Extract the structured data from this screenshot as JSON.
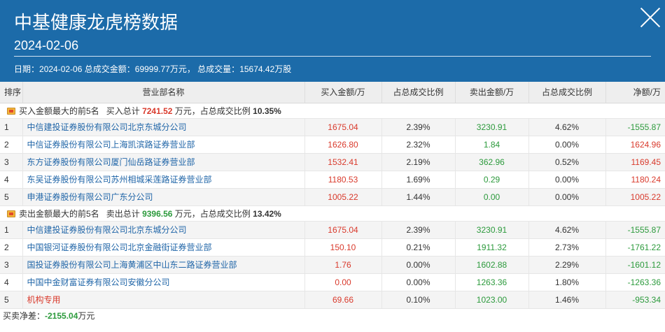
{
  "header": {
    "title": "中基健康龙虎榜数据",
    "date": "2024-02-06",
    "summary_date_label": "日期：",
    "summary_date": "2024-02-06",
    "summary_amount_label": "总成交金额：",
    "summary_amount": "69999.77万元，",
    "summary_volume_label": "总成交量：",
    "summary_volume": "15674.42万股"
  },
  "columns": [
    "排序",
    "营业部名称",
    "买入金额/万",
    "占总成交比例",
    "卖出金额/万",
    "占总成交比例",
    "净额/万"
  ],
  "buy_section": {
    "label": "买入金额最大的前5名",
    "total_label": "买入总计",
    "total": "7241.52",
    "total_unit": "万元，占总成交比例",
    "ratio": "10.35%"
  },
  "buy_rows": [
    {
      "rank": "1",
      "name": "中信建投证券股份有限公司北京东城分公司",
      "buy": "1675.04",
      "buy_pct": "2.39%",
      "sell": "3230.91",
      "sell_pct": "4.62%",
      "net": "-1555.87",
      "net_color": "green"
    },
    {
      "rank": "2",
      "name": "中信证券股份有限公司上海凯滨路证券营业部",
      "buy": "1626.80",
      "buy_pct": "2.32%",
      "sell": "1.84",
      "sell_pct": "0.00%",
      "net": "1624.96",
      "net_color": "red"
    },
    {
      "rank": "3",
      "name": "东方证券股份有限公司厦门仙岳路证券营业部",
      "buy": "1532.41",
      "buy_pct": "2.19%",
      "sell": "362.96",
      "sell_pct": "0.52%",
      "net": "1169.45",
      "net_color": "red"
    },
    {
      "rank": "4",
      "name": "东吴证券股份有限公司苏州相城采莲路证券营业部",
      "buy": "1180.53",
      "buy_pct": "1.69%",
      "sell": "0.29",
      "sell_pct": "0.00%",
      "net": "1180.24",
      "net_color": "red"
    },
    {
      "rank": "5",
      "name": "申港证券股份有限公司广东分公司",
      "buy": "1005.22",
      "buy_pct": "1.44%",
      "sell": "0.00",
      "sell_pct": "0.00%",
      "net": "1005.22",
      "net_color": "red"
    }
  ],
  "sell_section": {
    "label": "卖出金额最大的前5名",
    "total_label": "卖出总计",
    "total": "9396.56",
    "total_unit": "万元，占总成交比例",
    "ratio": "13.42%"
  },
  "sell_rows": [
    {
      "rank": "1",
      "name": "中信建投证券股份有限公司北京东城分公司",
      "buy": "1675.04",
      "buy_pct": "2.39%",
      "sell": "3230.91",
      "sell_pct": "4.62%",
      "net": "-1555.87",
      "net_color": "green"
    },
    {
      "rank": "2",
      "name": "中国银河证券股份有限公司北京金融街证券营业部",
      "buy": "150.10",
      "buy_pct": "0.21%",
      "sell": "1911.32",
      "sell_pct": "2.73%",
      "net": "-1761.22",
      "net_color": "green"
    },
    {
      "rank": "3",
      "name": "国投证券股份有限公司上海黄浦区中山东二路证券营业部",
      "buy": "1.76",
      "buy_pct": "0.00%",
      "sell": "1602.88",
      "sell_pct": "2.29%",
      "net": "-1601.12",
      "net_color": "green"
    },
    {
      "rank": "4",
      "name": "中国中金财富证券有限公司安徽分公司",
      "buy": "0.00",
      "buy_pct": "0.00%",
      "sell": "1263.36",
      "sell_pct": "1.80%",
      "net": "-1263.36",
      "net_color": "green"
    },
    {
      "rank": "5",
      "name": "机构专用",
      "buy": "69.66",
      "buy_pct": "0.10%",
      "sell": "1023.00",
      "sell_pct": "1.46%",
      "net": "-953.34",
      "net_color": "green",
      "name_color": "red"
    }
  ],
  "footer": {
    "label": "买卖净差：",
    "value": "-2155.04",
    "unit": "万元"
  },
  "colors": {
    "header_bg": "#1c6ba9",
    "buy": "#d93a2c",
    "sell": "#2c9a3c",
    "link": "#2166a8"
  }
}
